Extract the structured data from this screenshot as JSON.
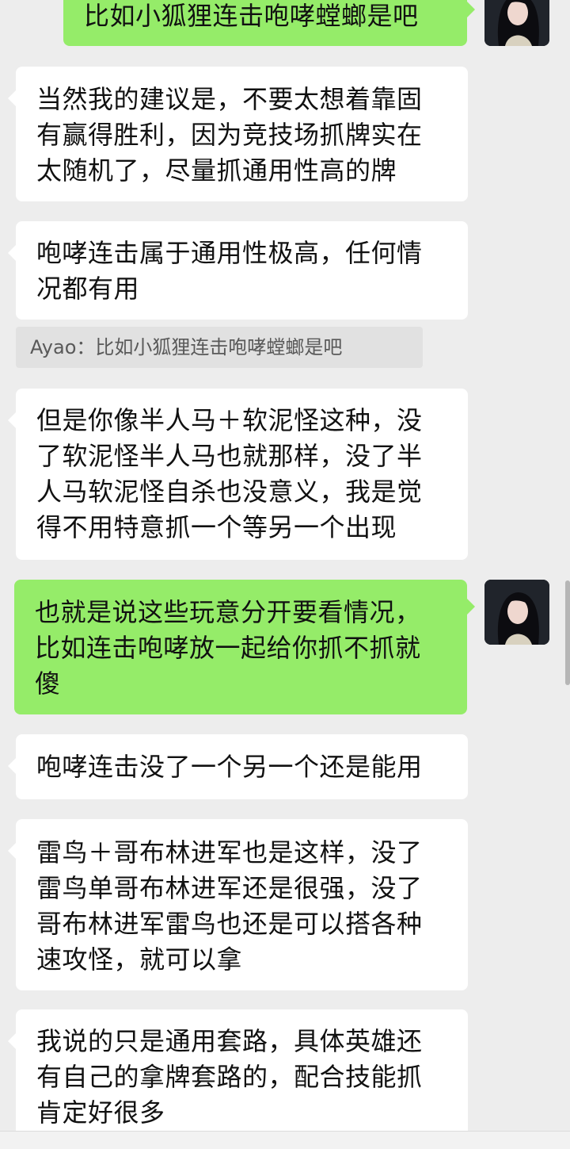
{
  "chat": {
    "messages": [
      {
        "side": "out",
        "text": "比如小狐狸连击咆哮螳螂是吧"
      },
      {
        "side": "in",
        "text": "当然我的建议是，不要太想着靠固\n有赢得胜利，因为竞技场抓牌实在\n太随机了，尽量抓通用性高的牌"
      },
      {
        "side": "in",
        "text": "咆哮连击属于通用性极高，任何情\n况都有用"
      },
      {
        "side": "in",
        "text": "但是你像半人马＋软泥怪这种，没\n了软泥怪半人马也就那样，没了半\n人马软泥怪自杀也没意义，我是觉\n得不用特意抓一个等另一个出现"
      },
      {
        "side": "out",
        "text": "也就是说这些玩意分开要看情况，\n比如连击咆哮放一起给你抓不抓就\n傻"
      },
      {
        "side": "in",
        "text": "咆哮连击没了一个另一个还是能用"
      },
      {
        "side": "in",
        "text": "雷鸟＋哥布林进军也是这样，没了\n雷鸟单哥布林进军还是很强，没了\n哥布林进军雷鸟也还是可以搭各种\n速攻怪，就可以拿"
      },
      {
        "side": "in",
        "text": "我说的只是通用套路，具体英雄还\n有自己的拿牌套路的，配合技能抓\n肯定好很多"
      }
    ],
    "quote": {
      "text": "Ayao：比如小狐狸连击咆哮螳螂是吧"
    }
  },
  "colors": {
    "background": "#ededed",
    "incoming_bubble": "#ffffff",
    "outgoing_bubble": "#95ec69",
    "quote_background": "#e1e1e1"
  }
}
